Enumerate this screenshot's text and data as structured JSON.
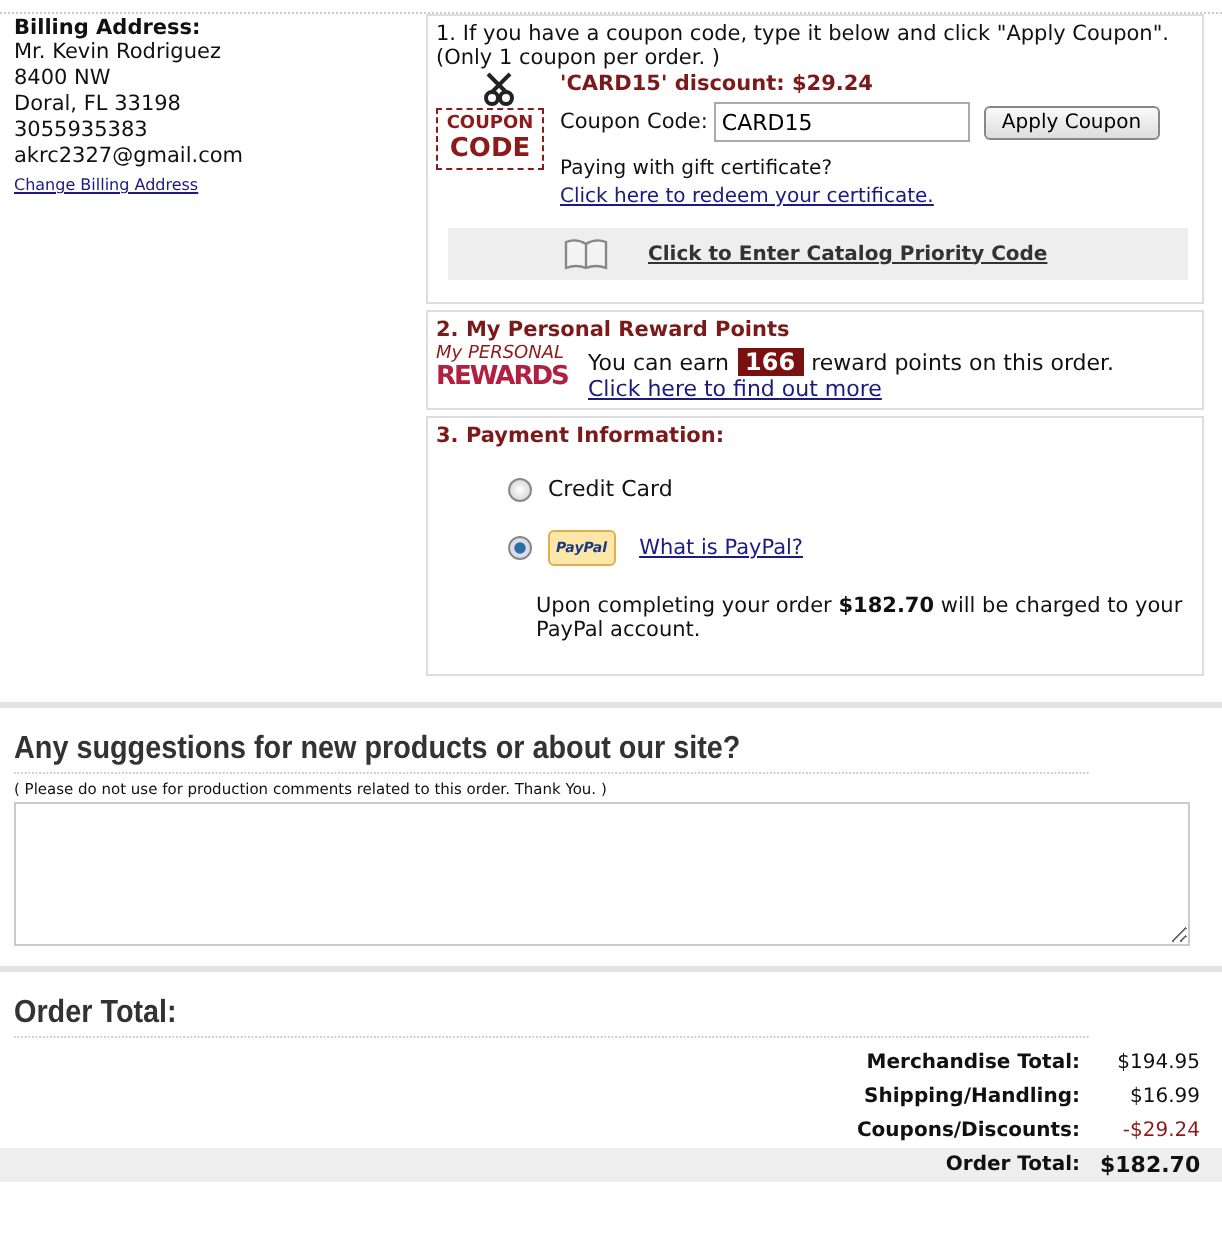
{
  "billing": {
    "heading": "Billing Address:",
    "lines": [
      "Mr. Kevin Rodriguez",
      "8400 NW",
      "Doral, FL 33198",
      "3055935383",
      "akrc2327@gmail.com"
    ],
    "change_link": "Change Billing Address"
  },
  "coupon": {
    "intro": "1. If you have a coupon code, type it below and click \"Apply Coupon\".",
    "note": "(Only 1 coupon per order. )",
    "logo_top": "COUPON",
    "logo_bottom": "CODE",
    "discount": "'CARD15' discount: $29.24",
    "label": "Coupon Code:",
    "value": "CARD15",
    "button": "Apply Coupon",
    "gift_text": "Paying with gift certificate?",
    "gift_link": "Click here to redeem your certificate.",
    "catalog_link": "Click to Enter Catalog Priority Code"
  },
  "rewards": {
    "title": "2. My Personal Reward Points",
    "logo_top": "My PERSONAL",
    "logo_bottom": "REWARDS",
    "before": "You can earn",
    "points": "166",
    "after": "reward points on this order.",
    "link": "Click here to find out more"
  },
  "payment": {
    "title": "3. Payment Information:",
    "options": [
      {
        "kind": "label",
        "label": "Credit Card",
        "selected": false
      },
      {
        "kind": "paypal",
        "logo": "PayPal",
        "link": "What is PayPal?",
        "selected": true
      }
    ],
    "note": "Upon completing your order **$182.70** will be charged to your PayPal account."
  },
  "suggestions": {
    "title": "Any suggestions for new products or about our site?",
    "note": "( Please do not use for production comments related to this order. Thank You. )"
  },
  "order_total": {
    "title": "Order Total:",
    "rows": [
      {
        "kind": "normal",
        "label": "Merchandise Total:",
        "value": "$194.95"
      },
      {
        "kind": "normal",
        "label": "Shipping/Handling:",
        "value": "$16.99"
      },
      {
        "kind": "discount",
        "label": "Coupons/Discounts:",
        "value": "-$29.24"
      },
      {
        "kind": "total",
        "label": "Order Total:",
        "value": "$182.70"
      }
    ]
  }
}
